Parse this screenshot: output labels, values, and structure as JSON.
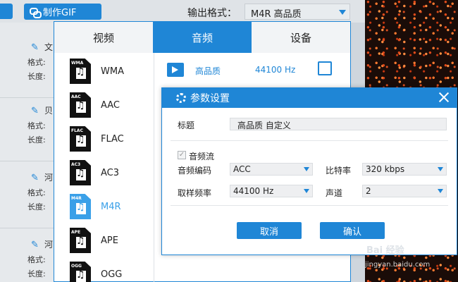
{
  "toolbar": {
    "make_gif_label": "制作GIF",
    "output_format_label": "输出格式：",
    "output_format_value": "M4R  高品质"
  },
  "bg_list": {
    "items": [
      {
        "frag": "文",
        "format_label": "格式:",
        "length_label": "长度:"
      },
      {
        "frag": "贝",
        "format_label": "格式:",
        "length_label": "长度:"
      },
      {
        "frag": "河",
        "format_label": "格式:",
        "length_label": "长度:"
      },
      {
        "frag": "河",
        "format_label": "格式:",
        "length_label": "长度:"
      }
    ]
  },
  "panel": {
    "tabs": [
      {
        "label": "视频",
        "active": false
      },
      {
        "label": "音频",
        "active": true
      },
      {
        "label": "设备",
        "active": false
      }
    ],
    "formats": [
      {
        "icon_label": "WMA",
        "name": "WMA"
      },
      {
        "icon_label": "AAC",
        "name": "AAC"
      },
      {
        "icon_label": "FLAC",
        "name": "FLAC"
      },
      {
        "icon_label": "AC3",
        "name": "AC3"
      },
      {
        "icon_label": "M4R",
        "name": "M4R",
        "selected": true
      },
      {
        "icon_label": "APE",
        "name": "APE"
      },
      {
        "icon_label": "OGG",
        "name": "OGG"
      }
    ],
    "preset": {
      "quality": "高品质",
      "frequency": "44100 Hz"
    }
  },
  "dialog": {
    "title": "参数设置",
    "title_field_label": "标题",
    "title_field_value": "高品质 自定义",
    "audio_stream_label": "音频流",
    "codec_label": "音频编码",
    "codec_value": "ACC",
    "bitrate_label": "比特率",
    "bitrate_value": "320 kbps",
    "sample_rate_label": "取样频率",
    "sample_rate_value": "44100 Hz",
    "channels_label": "声道",
    "channels_value": "2",
    "cancel_label": "取消",
    "confirm_label": "确认"
  },
  "watermark": {
    "text": "Bai 经验",
    "url": "jingyan.baidu.com"
  },
  "colors": {
    "accent": "#1f86d6",
    "selected": "#3aa0e8"
  }
}
